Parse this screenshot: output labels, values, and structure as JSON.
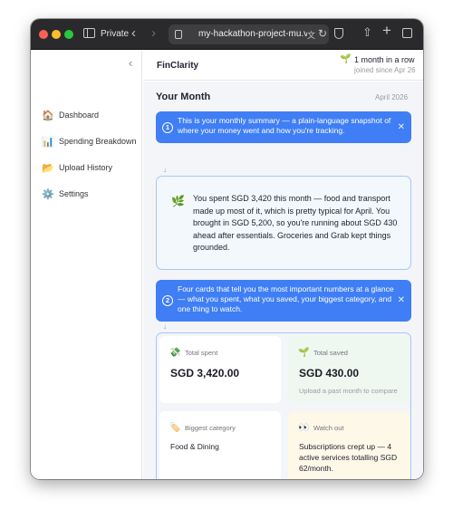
{
  "browser": {
    "private_label": "Private",
    "url": "my-hackathon-project-mu.vercel.app"
  },
  "sidebar": {
    "items": [
      {
        "label": "Dashboard",
        "icon": "house-icon"
      },
      {
        "label": "Spending Breakdown",
        "icon": "bar-chart-icon"
      },
      {
        "label": "Upload History",
        "icon": "folder-icon"
      },
      {
        "label": "Settings",
        "icon": "gear-icon"
      }
    ]
  },
  "header": {
    "brand": "FinClarity",
    "streak": "1 month in a row",
    "joined": "joined since Apr 26"
  },
  "main": {
    "title": "Your Month",
    "month": "April 2026",
    "tips": [
      {
        "number": "1",
        "text": "This is your monthly summary — a plain-language snapshot of where your money went and how you're tracking."
      },
      {
        "number": "2",
        "text": "Four cards that tell you the most important numbers at a glance — what you spent, what you saved, your biggest category, and one thing to watch."
      }
    ],
    "summary": "You spent SGD 3,420 this month — food and transport made up most of it, which is pretty typical for April. You brought in SGD 5,200, so you're running about SGD 430 ahead after essentials. Groceries and Grab kept things grounded.",
    "cards": {
      "total_spent": {
        "label": "Total spent",
        "value": "SGD 3,420.00"
      },
      "total_saved": {
        "label": "Total saved",
        "value": "SGD 430.00",
        "sub": "Upload a past month to compare"
      },
      "biggest_category": {
        "label": "Biggest category",
        "value": "Food & Dining"
      },
      "watch_out": {
        "label": "Watch out",
        "value": "Subscriptions crept up — 4 active services totalling SGD 62/month."
      }
    }
  },
  "colors": {
    "accent": "#3f7ef5",
    "saved_card": "#eef8f1",
    "watch_card": "#fdf8e8"
  }
}
